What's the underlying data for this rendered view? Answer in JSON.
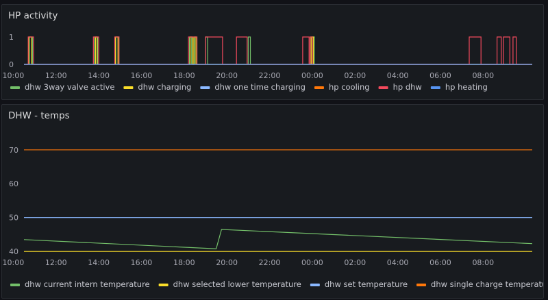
{
  "panels": [
    {
      "title": "HP activity"
    },
    {
      "title": "DHW - temps"
    }
  ],
  "chart_data": [
    {
      "type": "line",
      "title": "HP activity",
      "x_ticks": [
        "12:00",
        "14:00",
        "16:00",
        "18:00",
        "20:00",
        "22:00",
        "00:00",
        "02:00",
        "04:00",
        "06:00",
        "08:00",
        "10:00"
      ],
      "y_ticks": [
        0,
        1
      ],
      "ylim": [
        0,
        1
      ],
      "legend_position": "bottom",
      "series": [
        {
          "name": "dhw 3way valve active",
          "color": "#73bf69",
          "pulses": [
            [
              10.75,
              10.9
            ],
            [
              13.8,
              13.95
            ],
            [
              14.8,
              14.95
            ],
            [
              18.25,
              18.35
            ],
            [
              18.5,
              18.6
            ],
            [
              19.0,
              19.1
            ],
            [
              21.0,
              21.1
            ],
            [
              23.9,
              24.1
            ]
          ]
        },
        {
          "name": "dhw charging",
          "color": "#fade2a",
          "pulses": [
            [
              10.72,
              10.85
            ],
            [
              13.85,
              13.92
            ],
            [
              14.78,
              14.9
            ],
            [
              18.28,
              18.4
            ],
            [
              18.45,
              18.55
            ],
            [
              23.95,
              24.05
            ]
          ]
        },
        {
          "name": "dhw one time charging",
          "color": "#8ab8ff",
          "pulses": []
        },
        {
          "name": "hp cooling",
          "color": "#ff780a",
          "pulses": []
        },
        {
          "name": "hp dhw",
          "color": "#f2495c",
          "pulses": [
            [
              10.7,
              10.95
            ],
            [
              13.75,
              14.0
            ],
            [
              14.75,
              14.95
            ],
            [
              18.2,
              18.6
            ],
            [
              19.0,
              19.8
            ],
            [
              20.45,
              20.95
            ],
            [
              23.55,
              23.85
            ],
            [
              23.9,
              24.0
            ],
            [
              31.35,
              31.9
            ],
            [
              32.65,
              32.85
            ],
            [
              32.95,
              33.25
            ],
            [
              33.4,
              33.55
            ]
          ]
        },
        {
          "name": "hp heating",
          "color": "#5794f2",
          "pulses": []
        }
      ]
    },
    {
      "type": "line",
      "title": "DHW - temps",
      "x_ticks": [
        "12:00",
        "14:00",
        "16:00",
        "18:00",
        "20:00",
        "22:00",
        "00:00",
        "02:00",
        "04:00",
        "06:00",
        "08:00",
        "10:00"
      ],
      "y_ticks": [
        40,
        50,
        60,
        70
      ],
      "ylim": [
        38,
        74
      ],
      "legend_position": "bottom",
      "series": [
        {
          "name": "dhw current intern temperature",
          "color": "#73bf69",
          "points": [
            [
              10.5,
              43.5
            ],
            [
              19.5,
              40.8
            ],
            [
              19.75,
              46.5
            ],
            [
              34.3,
              42.3
            ]
          ]
        },
        {
          "name": "dhw selected lower temperature",
          "color": "#fade2a",
          "points": [
            [
              10.5,
              40
            ],
            [
              34.3,
              40
            ]
          ]
        },
        {
          "name": "dhw set temperature",
          "color": "#8ab8ff",
          "points": [
            [
              10.5,
              50
            ],
            [
              34.3,
              50
            ]
          ]
        },
        {
          "name": "dhw single charge temperature",
          "color": "#ff780a",
          "points": [
            [
              10.5,
              70
            ],
            [
              34.3,
              70
            ]
          ]
        }
      ]
    }
  ]
}
